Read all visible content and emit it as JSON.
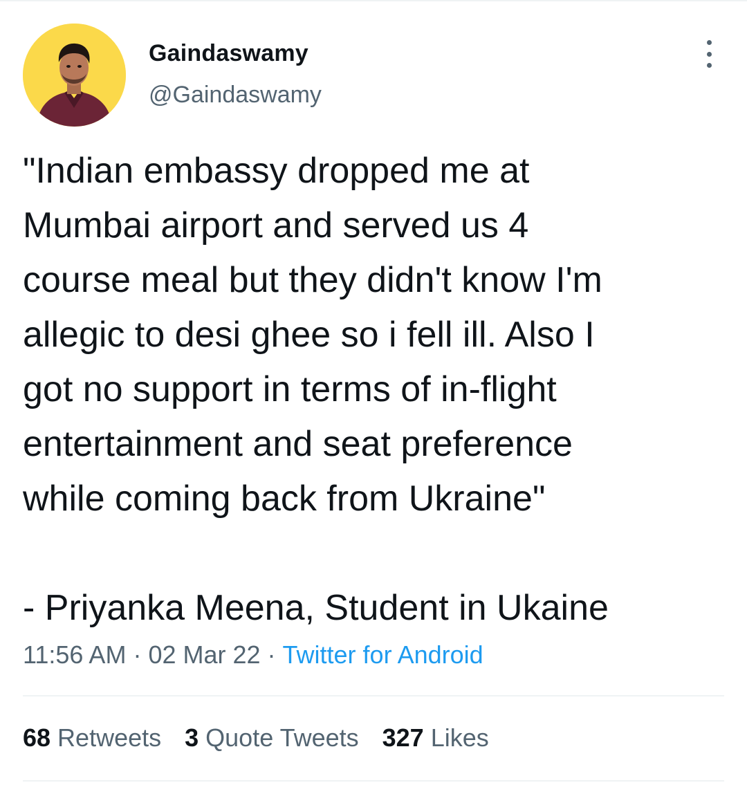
{
  "tweet": {
    "author": {
      "display_name": "Gaindaswamy",
      "handle": "@Gaindaswamy",
      "avatar_bg": "#fbd94a"
    },
    "text": "\"Indian embassy dropped me at\nMumbai airport and served us 4\ncourse meal but they didn't know I'm\nallegic to desi ghee so i fell ill. Also I\ngot no support in terms of in-flight\nentertainment and seat preference\nwhile coming back from Ukraine\"\n\n- Priyanka Meena, Student in Ukaine",
    "time": "11:56 AM",
    "date": "02 Mar 22",
    "separator": "·",
    "source": "Twitter for Android",
    "stats": {
      "retweets_count": "68",
      "retweets_label": "Retweets",
      "quotes_count": "3",
      "quotes_label": "Quote Tweets",
      "likes_count": "327",
      "likes_label": "Likes"
    }
  },
  "colors": {
    "text_primary": "#0f1419",
    "text_secondary": "#536471",
    "link": "#1d9bf0",
    "divider": "#eff3f4"
  },
  "icons": {
    "more": "more-horizontal-icon"
  }
}
